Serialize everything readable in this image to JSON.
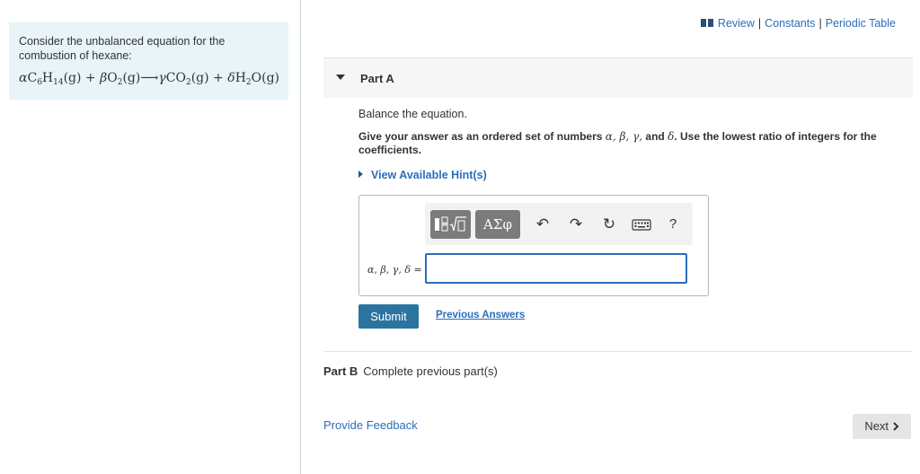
{
  "intro": {
    "text": "Consider the unbalanced equation for the combustion of hexane:",
    "equation": {
      "c1": "α",
      "r1": "C",
      "r1s1": "6",
      "r1b": "H",
      "r1s2": "14",
      "r1p": "(g) + ",
      "c2": "β",
      "r2": "O",
      "r2s": "2",
      "r2p": "(g)⟶",
      "c3": "γ",
      "r3": "CO",
      "r3s": "2",
      "r3p": "(g) + ",
      "c4": "δ",
      "r4": "H",
      "r4s": "2",
      "r4p": "O(g)"
    }
  },
  "top_links": {
    "icon": "book-icon",
    "review": "Review",
    "sep": "|",
    "constants": "Constants",
    "periodic": "Periodic Table"
  },
  "part_a": {
    "title": "Part A",
    "instruction": "Balance the equation.",
    "directions_pre": "Give your answer as an ordered set of numbers ",
    "directions_vars": "α, β, γ,",
    "directions_and": " and ",
    "directions_delta": "δ",
    "directions_post": ". Use the lowest ratio of integers for the coefficients.",
    "hint": "View Available Hint(s)"
  },
  "toolbar": {
    "templates_icon": "templates-icon",
    "greek_label": "ΑΣφ",
    "undo": "↶",
    "redo": "↷",
    "reset": "↻",
    "help": "?"
  },
  "answer": {
    "label": "α, β, γ, δ =",
    "value": ""
  },
  "actions": {
    "submit": "Submit",
    "previous": "Previous Answers"
  },
  "part_b": {
    "label": "Part B",
    "status": "Complete previous part(s)"
  },
  "footer": {
    "feedback": "Provide Feedback",
    "next": "Next"
  },
  "colors": {
    "link": "#2a6ebb",
    "submit": "#2c74a0",
    "intro_bg": "#e8f4f7"
  }
}
